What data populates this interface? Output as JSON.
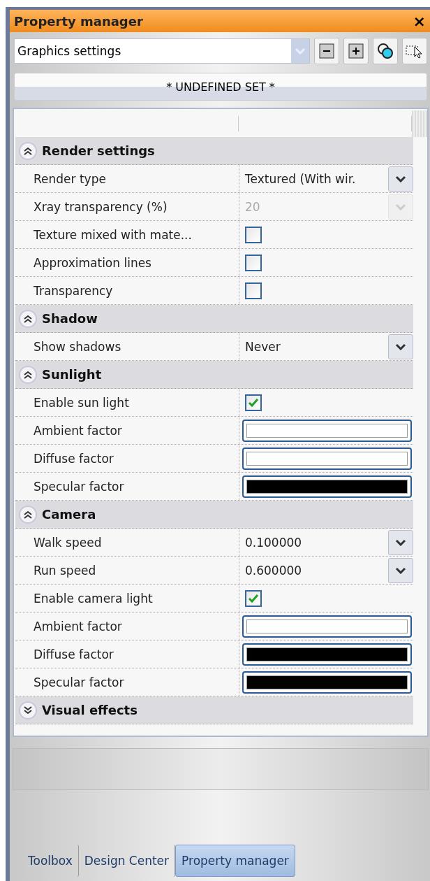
{
  "window": {
    "title": "Property manager",
    "close": "×"
  },
  "toolbar": {
    "dropdown": {
      "value": "Graphics settings"
    },
    "buttons": [
      {
        "kind": "collapse"
      },
      {
        "kind": "expand"
      },
      {
        "kind": "filter"
      },
      {
        "kind": "select"
      }
    ]
  },
  "set_button": "* UNDEFINED SET *",
  "groups": [
    {
      "title": "Render settings",
      "expanded": true,
      "rows": [
        {
          "label": "Render type",
          "kind": "dropdown",
          "value": "Textured (With wir.",
          "disabled": false
        },
        {
          "label": "Xray transparency (%)",
          "kind": "dropdown",
          "value": "20",
          "disabled": true
        },
        {
          "label": "Texture mixed with mate...",
          "kind": "checkbox",
          "checked": false
        },
        {
          "label": "Approximation lines",
          "kind": "checkbox",
          "checked": false
        },
        {
          "label": "Transparency",
          "kind": "checkbox",
          "checked": false
        }
      ]
    },
    {
      "title": "Shadow",
      "expanded": true,
      "rows": [
        {
          "label": "Show shadows",
          "kind": "dropdown",
          "value": "Never",
          "disabled": false
        }
      ]
    },
    {
      "title": "Sunlight",
      "expanded": true,
      "rows": [
        {
          "label": "Enable sun light",
          "kind": "checkbox",
          "checked": true
        },
        {
          "label": "Ambient factor",
          "kind": "color",
          "color": "#ffffff"
        },
        {
          "label": "Diffuse factor",
          "kind": "color",
          "color": "#ffffff"
        },
        {
          "label": "Specular factor",
          "kind": "color",
          "color": "#000000"
        }
      ]
    },
    {
      "title": "Camera",
      "expanded": true,
      "rows": [
        {
          "label": "Walk speed",
          "kind": "dropdown",
          "value": "0.100000",
          "disabled": false
        },
        {
          "label": "Run speed",
          "kind": "dropdown",
          "value": "0.600000",
          "disabled": false
        },
        {
          "label": "Enable camera light",
          "kind": "checkbox",
          "checked": true
        },
        {
          "label": "Ambient factor",
          "kind": "color",
          "color": "#ffffff"
        },
        {
          "label": "Diffuse factor",
          "kind": "color",
          "color": "#000000"
        },
        {
          "label": "Specular factor",
          "kind": "color",
          "color": "#000000"
        }
      ]
    },
    {
      "title": "Visual effects",
      "expanded": false
    }
  ],
  "tabs": [
    {
      "label": "Toolbox",
      "selected": false
    },
    {
      "label": "Design Center",
      "selected": false
    },
    {
      "label": "Property manager",
      "selected": true
    }
  ]
}
